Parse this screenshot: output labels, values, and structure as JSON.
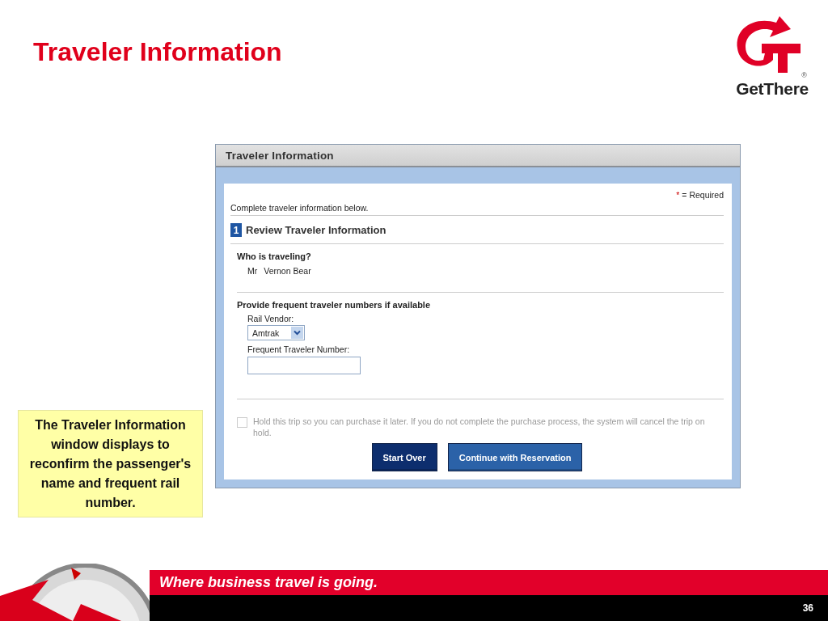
{
  "slide": {
    "title": "Traveler Information",
    "logo": {
      "wordmark": "GetThere",
      "registered": "®"
    },
    "callout": "The Traveler Information window displays to reconfirm the passenger's name and frequent rail number.",
    "footer": {
      "tagline": "Where business travel is going.",
      "page_number": "36"
    }
  },
  "window": {
    "title": "Traveler Information",
    "required_marker": "*",
    "required_note": "= Required",
    "intro": "Complete traveler information below.",
    "step": {
      "number": "1",
      "title": "Review Traveler Information"
    },
    "traveler": {
      "heading": "Who is traveling?",
      "prefix": "Mr",
      "name": "Vernon Bear"
    },
    "frequent": {
      "heading": "Provide frequent traveler numbers if available",
      "vendor_label": "Rail Vendor:",
      "vendor_value": "Amtrak",
      "number_label": "Frequent Traveler Number:"
    },
    "hold": {
      "checked": false,
      "disabled": true,
      "label": "Hold this trip so you can purchase it later. If you do not complete the purchase process, the system will cancel the trip on hold."
    },
    "buttons": [
      {
        "label": "Start Over",
        "kind": "secondary"
      },
      {
        "label": "Continue with Reservation",
        "kind": "primary"
      }
    ]
  }
}
